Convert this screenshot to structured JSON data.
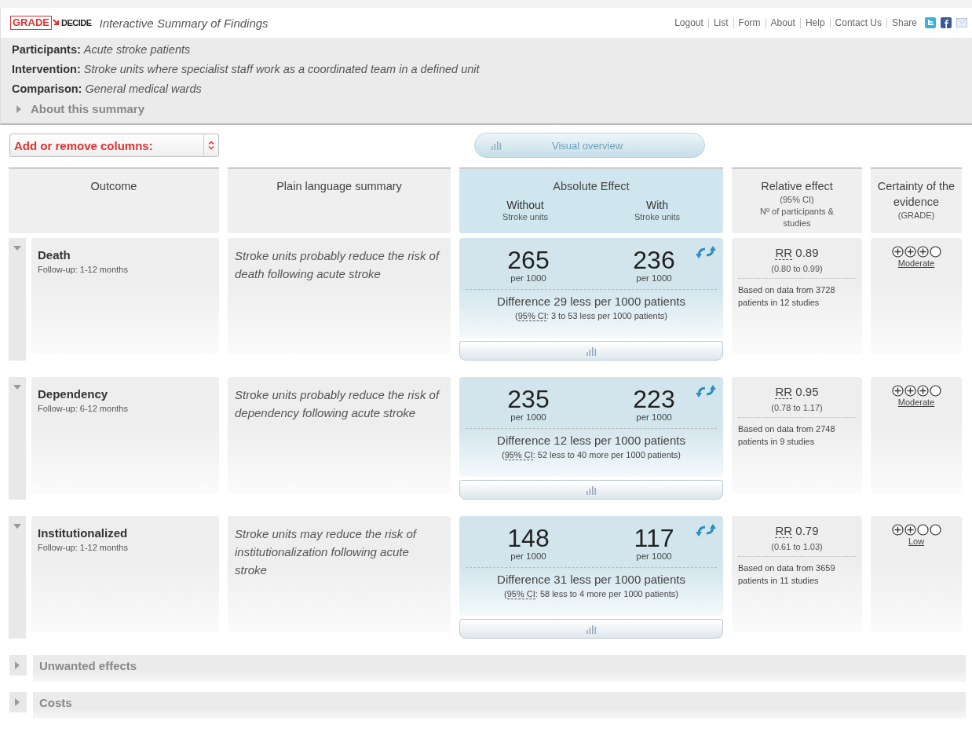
{
  "header": {
    "logo": {
      "grade": "GRADE",
      "decide": "DECIDE"
    },
    "title": "Interactive Summary of Findings",
    "nav": [
      "Logout",
      "List",
      "Form",
      "About",
      "Help",
      "Contact Us"
    ],
    "share": "Share"
  },
  "question": {
    "fields": [
      {
        "label": "Participants:",
        "value": "Acute stroke patients"
      },
      {
        "label": "Intervention:",
        "value": "Stroke units where specialist staff work as a coordinated team in a defined unit"
      },
      {
        "label": "Comparison:",
        "value": "General medical wards"
      }
    ],
    "about": {
      "label": "About this summary",
      "expanded": false
    }
  },
  "columns_select": {
    "label": "Add or remove columns:"
  },
  "visual_overview": {
    "label": "Visual overview"
  },
  "table": {
    "columns": {
      "outcome": "Outcome",
      "summary": "Plain language summary",
      "absolute": {
        "title": "Absolute Effect",
        "without": "Without",
        "without_sub": "Stroke units",
        "with": "With",
        "with_sub": "Stroke units"
      },
      "relative": {
        "title": "Relative effect",
        "ci": "(95% CI)",
        "participants": "Nº of participants & studies"
      },
      "certainty": {
        "title": "Certainty of the evidence",
        "sub": "(GRADE)"
      }
    },
    "rows": [
      {
        "outcome": "Death",
        "followup": "Follow-up: 1-12 months",
        "expanded": true,
        "summary": "Stroke units probably reduce the risk of death following acute stroke",
        "without": "265",
        "without_unit": "per 1000",
        "with": "236",
        "with_unit": "per 1000",
        "difference": "Difference 29 less per 1000 patients",
        "ci_open": "(",
        "ci_label": "95% CI",
        "ci_rest": ": 3 to 53 less per 1000 patients)",
        "rr_label": "RR",
        "rr": "0.89",
        "rr_ci": "(0.80 to 0.99)",
        "based_on": "Based on data from 3728 patients in 12 studies",
        "stars": 3,
        "certainty": "Moderate"
      },
      {
        "outcome": "Dependency",
        "followup": "Follow-up: 6-12 months",
        "expanded": true,
        "summary": "Stroke units probably reduce the risk of dependency following acute stroke",
        "without": "235",
        "without_unit": "per 1000",
        "with": "223",
        "with_unit": "per 1000",
        "difference": "Difference 12 less per 1000 patients",
        "ci_open": "(",
        "ci_label": "95% CI",
        "ci_rest": ": 52 less to 40 more per 1000 patients)",
        "rr_label": "RR",
        "rr": "0.95",
        "rr_ci": "(0.78 to 1.17)",
        "based_on": "Based on data from 2748 patients in 9 studies",
        "stars": 3,
        "certainty": "Moderate"
      },
      {
        "outcome": "Institutionalized",
        "followup": "Follow-up: 1-12 months",
        "expanded": true,
        "summary": "Stroke units may reduce the risk of institutionalization following acute stroke",
        "without": "148",
        "without_unit": "per 1000",
        "with": "117",
        "with_unit": "per 1000",
        "difference": "Difference 31 less per 1000 patients",
        "ci_open": "(",
        "ci_label": "95% CI",
        "ci_rest": ": 58 less to 4 more per 1000 patients)",
        "rr_label": "RR",
        "rr": "0.79",
        "rr_ci": "(0.61 to 1.03)",
        "based_on": "Based on data from 3659 patients in 11 studies",
        "stars": 2,
        "certainty": "Low"
      }
    ]
  },
  "sections": [
    {
      "label": "Unwanted effects",
      "expanded": false
    },
    {
      "label": "Costs",
      "expanded": false
    }
  ]
}
